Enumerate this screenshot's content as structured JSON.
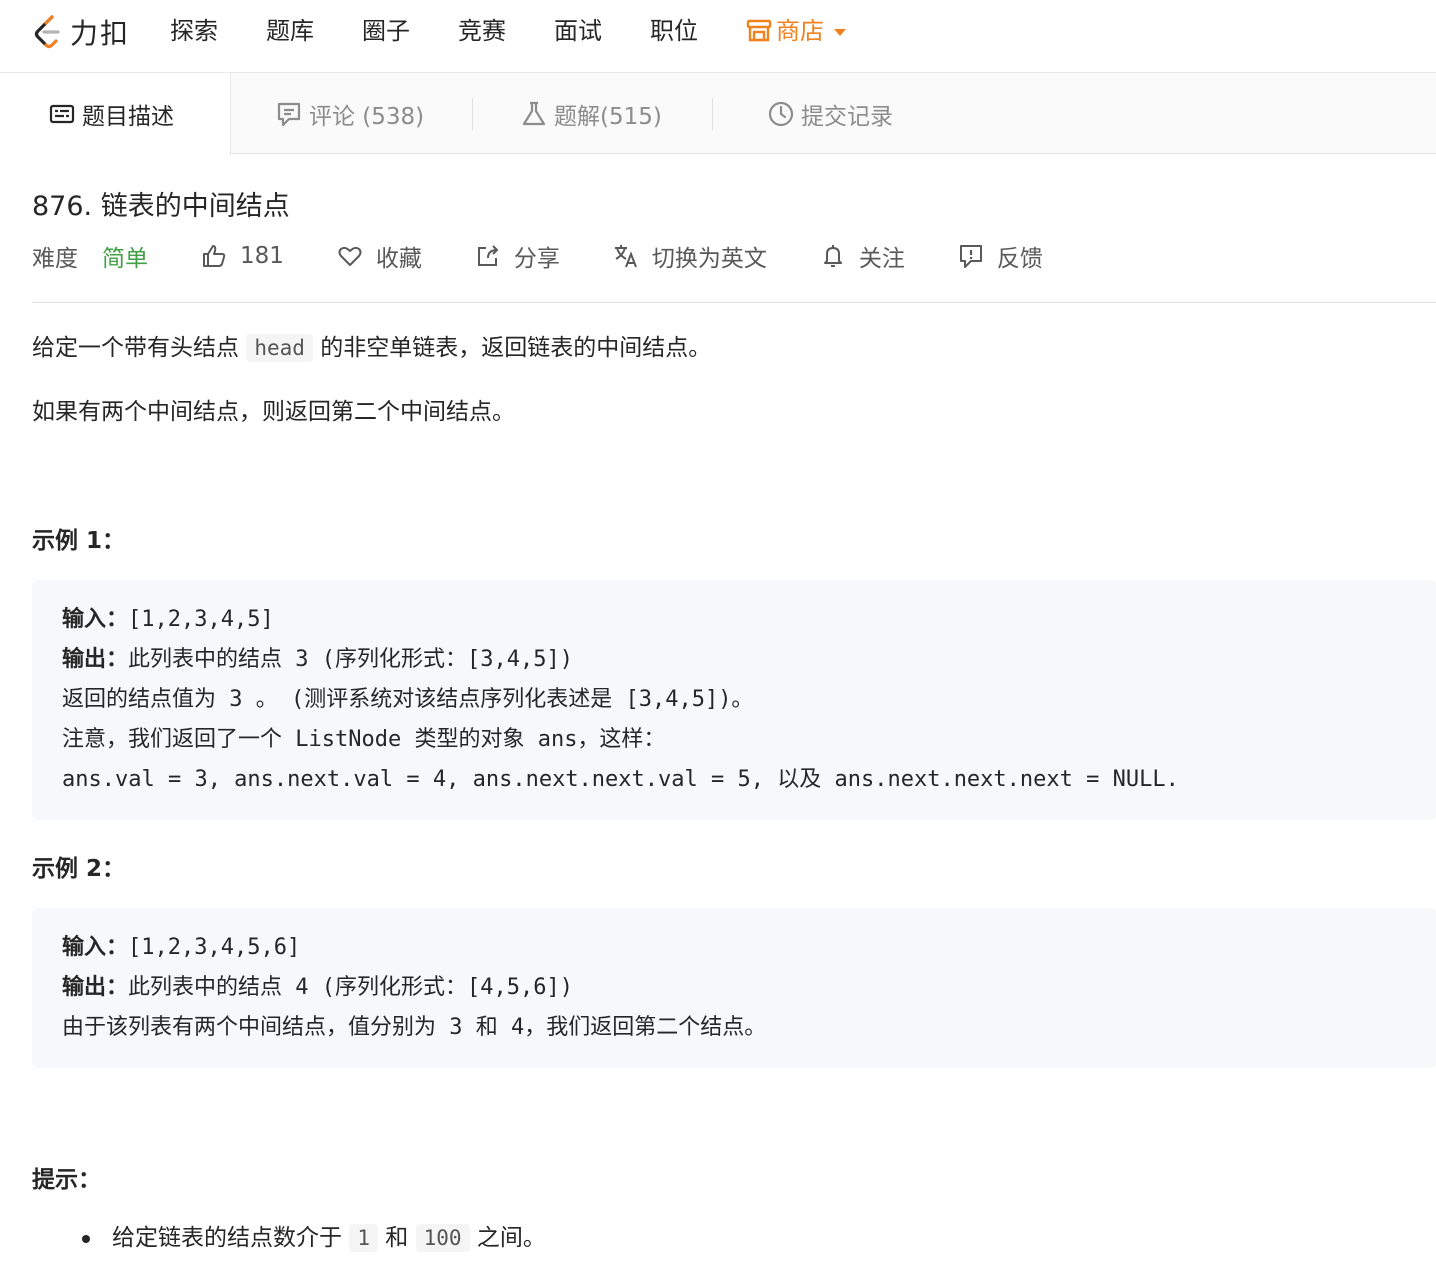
{
  "nav": {
    "logo_text": "力扣",
    "items": [
      "探索",
      "题库",
      "圈子",
      "竞赛",
      "面试",
      "职位"
    ],
    "store_label": "商店"
  },
  "tabs": {
    "description": "题目描述",
    "comments": "评论 (538)",
    "solutions": "题解(515)",
    "submissions": "提交记录"
  },
  "problem": {
    "title": "876. 链表的中间结点",
    "difficulty_label": "难度",
    "difficulty": "简单",
    "likes": "181",
    "favorite_label": "收藏",
    "share_label": "分享",
    "switch_lang_label": "切换为英文",
    "follow_label": "关注",
    "feedback_label": "反馈"
  },
  "description": {
    "p1_before": "给定一个带有头结点 ",
    "p1_code": "head",
    "p1_after": " 的非空单链表，返回链表的中间结点。",
    "p2": "如果有两个中间结点，则返回第二个中间结点。"
  },
  "examples": [
    {
      "title": "示例 1：",
      "input_label": "输入：",
      "input_value": "[1,2,3,4,5]",
      "output_label": "输出：",
      "output_value": "此列表中的结点 3 (序列化形式：[3,4,5])",
      "lines": [
        "返回的结点值为 3 。 (测评系统对该结点序列化表述是 [3,4,5])。",
        "注意，我们返回了一个 ListNode 类型的对象 ans，这样：",
        "ans.val = 3, ans.next.val = 4, ans.next.next.val = 5, 以及 ans.next.next.next = NULL."
      ]
    },
    {
      "title": "示例 2：",
      "input_label": "输入：",
      "input_value": "[1,2,3,4,5,6]",
      "output_label": "输出：",
      "output_value": "此列表中的结点 4 (序列化形式：[4,5,6])",
      "lines": [
        "由于该列表有两个中间结点，值分别为 3 和 4，我们返回第二个结点。"
      ]
    }
  ],
  "hints": {
    "title": "提示：",
    "item_before": "给定链表的结点数介于 ",
    "item_code1": "1",
    "item_middle": " 和 ",
    "item_code2": "100",
    "item_after": " 之间。"
  },
  "colors": {
    "accent_store": "#f0811f",
    "difficulty_easy": "#43a047"
  }
}
